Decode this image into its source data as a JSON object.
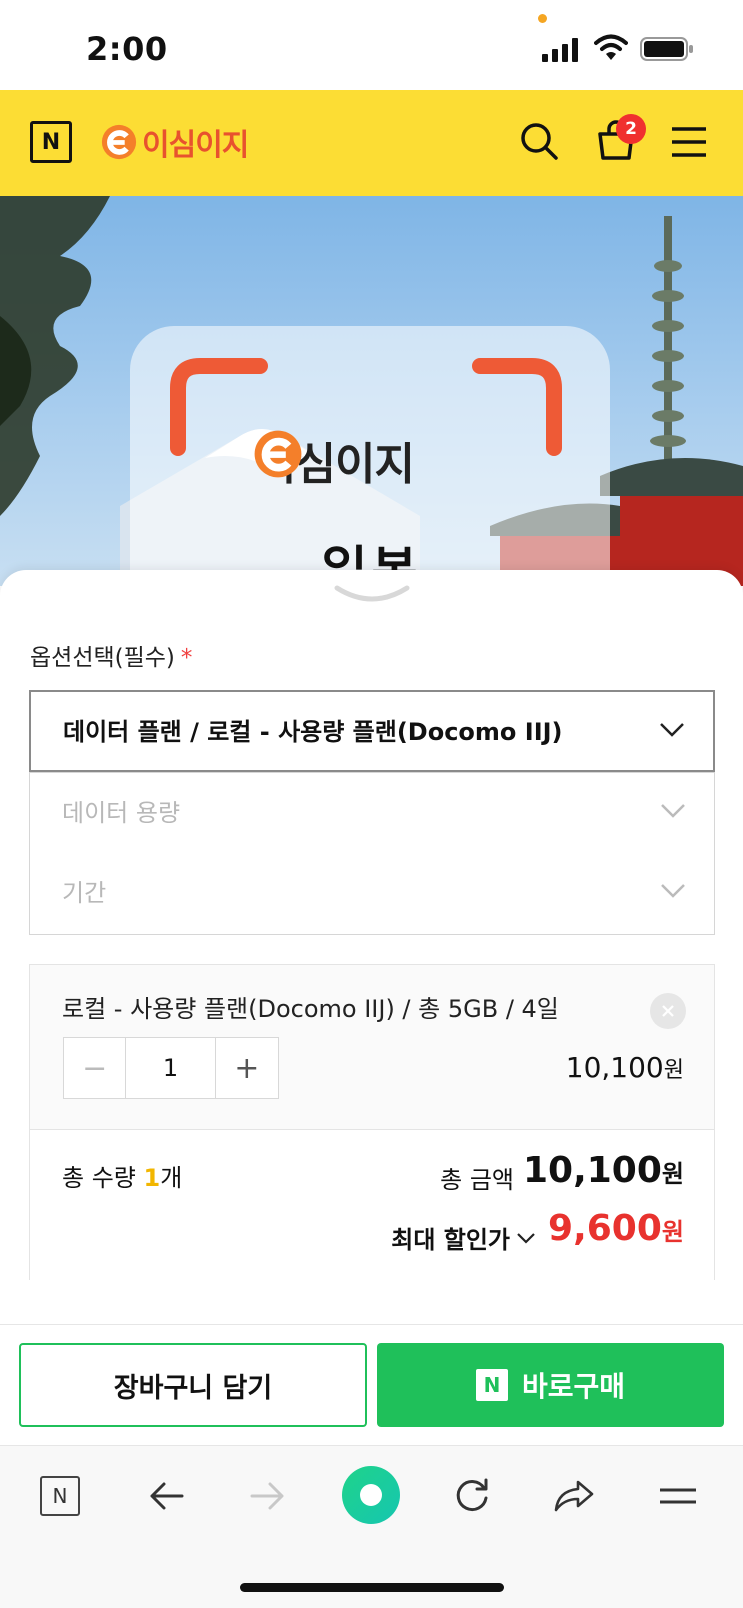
{
  "status_bar": {
    "time": "2:00"
  },
  "header": {
    "n_badge": "N",
    "brand": "이심이지",
    "icons": [
      "search-icon",
      "cart-icon",
      "menu-icon"
    ],
    "cart_count": "2",
    "accent_color": "#fcdd34"
  },
  "banner": {
    "brand": "이심이지",
    "title": "일본"
  },
  "options": {
    "label": "옵션선택(필수)",
    "required_mark": "*",
    "selects": [
      {
        "text": "데이터 플랜 / 로컬 - 사용량 플랜(Docomo IIJ)",
        "state": "selected"
      },
      {
        "text": "데이터 용량",
        "state": "placeholder"
      },
      {
        "text": "기간",
        "state": "placeholder"
      }
    ]
  },
  "selected_item": {
    "name": "로컬 - 사용량 플랜(Docomo IIJ) / 총 5GB / 4일",
    "minus": "−",
    "quantity": "1",
    "plus": "+",
    "price": "10,100",
    "currency": "원"
  },
  "totals": {
    "qty_prefix": "총 수량 ",
    "qty_value": "1",
    "qty_suffix": "개",
    "amount_label": "총 금액",
    "amount": "10,100",
    "currency": "원",
    "discount_label": "최대 할인가",
    "discount_amount": "9,600"
  },
  "actions": {
    "cart_label": "장바구니 담기",
    "buy_mark": "N",
    "buy_label": "바로구매",
    "buy_color": "#1fc05a"
  },
  "browser_toolbar": {
    "n_badge": "N",
    "icons": [
      "back-arrow-icon",
      "forward-arrow-icon",
      "home-icon",
      "reload-icon",
      "share-icon",
      "menu-icon"
    ]
  }
}
